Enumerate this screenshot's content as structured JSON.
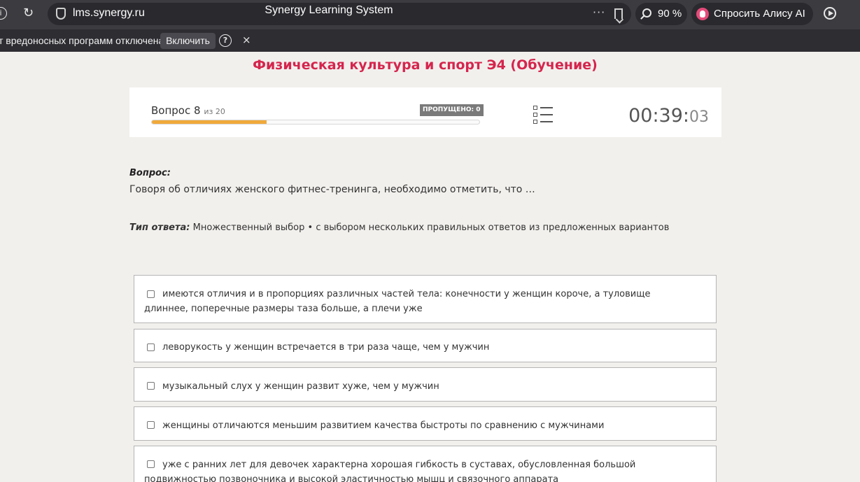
{
  "browser": {
    "url": "lms.synergy.ru",
    "title": "Synergy Learning System",
    "zoom": "90 %",
    "alice_label": "Спросить Алису AI",
    "more_dots": "···"
  },
  "notification": {
    "text": "т вредоносных программ отключена",
    "enable_label": "Включить",
    "help_glyph": "?",
    "close_glyph": "×"
  },
  "course": {
    "title": "Физическая культура и спорт Э4 (Обучение)"
  },
  "quiz": {
    "question_label": "Вопрос 8",
    "question_of": "из 20",
    "current": 8,
    "total": 20,
    "progress_fraction": 0.35,
    "skipped_label": "ПРОПУЩЕНО: 0",
    "timer_main": "00:39:",
    "timer_seconds": "03"
  },
  "question": {
    "label": "Вопрос:",
    "text": "Говоря об отличиях женского фитнес-тренинга, необходимо отметить, что …",
    "type_label": "Тип ответа:",
    "type_value": " Множественный выбор • с выбором нескольких правильных ответов из предложенных вариантов"
  },
  "answers": [
    {
      "text": "имеются отличия и в пропорциях различных частей тела: конечности у женщин короче, а туловище длиннее, поперечные размеры таза больше, а плечи уже",
      "checked": false
    },
    {
      "text": "леворукость у женщин встречается в три раза чаще, чем у мужчин",
      "checked": false
    },
    {
      "text": "музыкальный слух у женщин развит хуже, чем у мужчин",
      "checked": false
    },
    {
      "text": "женщины отличаются меньшим развитием качества быстроты по сравнению с мужчинами",
      "checked": false
    },
    {
      "text": "уже с ранних лет для девочек характерна хорошая гибкость в суставах, обусловленная большой подвижностью позвоночника и высокой эластичностью мышц и связочного аппарата",
      "checked": false
    }
  ]
}
